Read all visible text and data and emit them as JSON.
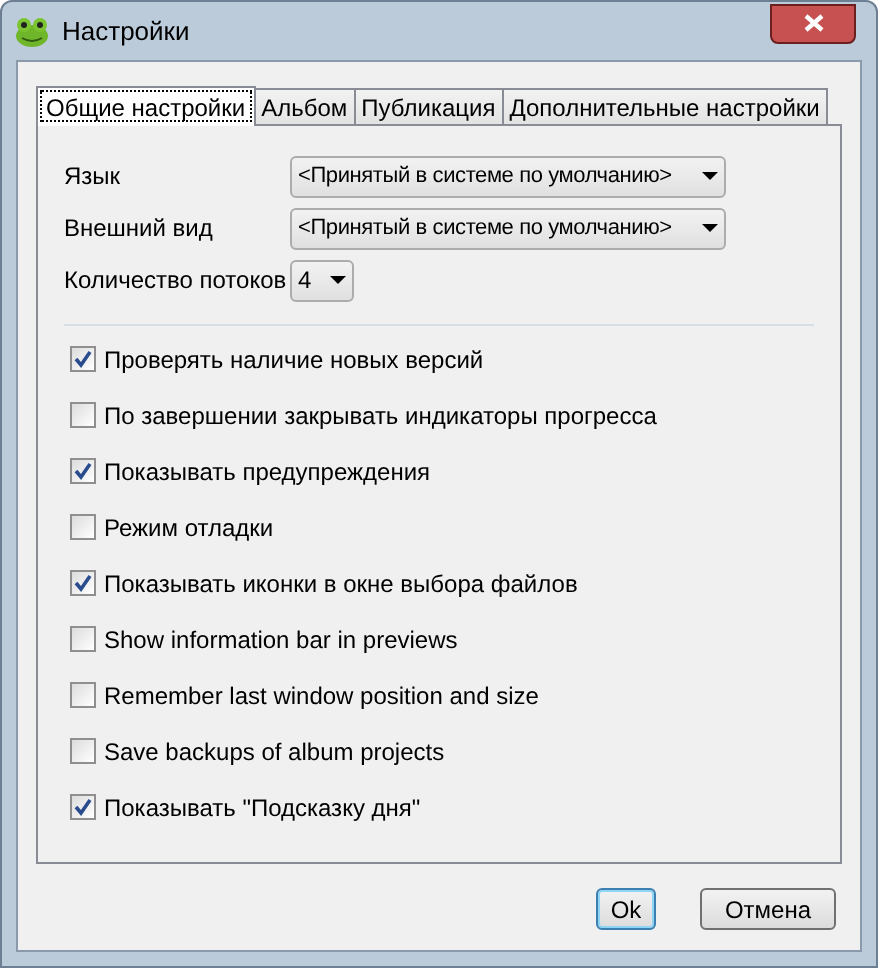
{
  "window": {
    "title": "Настройки"
  },
  "tabs": [
    {
      "label": "Общие настройки",
      "selected": true
    },
    {
      "label": "Альбом",
      "selected": false
    },
    {
      "label": "Публикация",
      "selected": false
    },
    {
      "label": "Дополнительные настройки",
      "selected": false
    }
  ],
  "fields": [
    {
      "label": "Язык",
      "value": "<Принятый в системе по умолчанию>"
    },
    {
      "label": "Внешний вид",
      "value": "<Принятый в системе по умолчанию>"
    },
    {
      "label": "Количество потоков",
      "value": "4"
    }
  ],
  "options": [
    {
      "label": "Проверять наличие новых версий",
      "checked": true
    },
    {
      "label": "По завершении закрывать индикаторы прогресса",
      "checked": false
    },
    {
      "label": "Показывать предупреждения",
      "checked": true
    },
    {
      "label": "Режим отладки",
      "checked": false
    },
    {
      "label": "Показывать иконки в окне выбора файлов",
      "checked": true
    },
    {
      "label": "Show information bar in previews",
      "checked": false
    },
    {
      "label": "Remember last window position and size",
      "checked": false
    },
    {
      "label": "Save backups of album projects",
      "checked": false
    },
    {
      "label": "Показывать \"Подсказку дня\"",
      "checked": true
    }
  ],
  "buttons": [
    {
      "label": "Ok",
      "default": true
    },
    {
      "label": "Отмена",
      "default": false
    }
  ]
}
